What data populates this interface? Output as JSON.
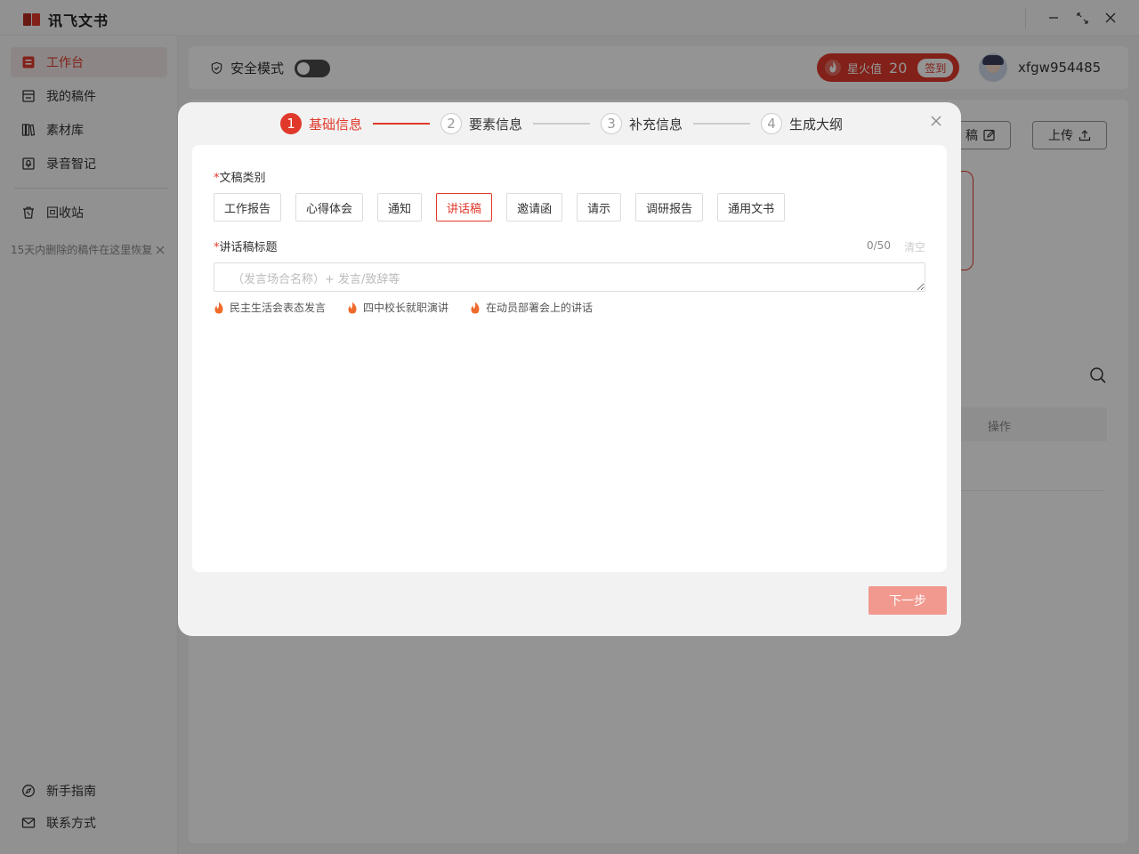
{
  "app": {
    "title": "讯飞文书"
  },
  "window": {
    "minimize_icon": "minimize-icon",
    "maximize_icon": "maximize-icon",
    "close_icon": "close-icon"
  },
  "sidebar": {
    "items": [
      {
        "label": "工作台",
        "icon": "workbench-icon",
        "active": true
      },
      {
        "label": "我的稿件",
        "icon": "drafts-icon",
        "active": false
      },
      {
        "label": "素材库",
        "icon": "library-icon",
        "active": false
      },
      {
        "label": "录音智记",
        "icon": "recording-icon",
        "active": false
      },
      {
        "label": "回收站",
        "icon": "trash-icon",
        "active": false
      }
    ],
    "recycle_tip": "15天内删除的稿件在这里恢复",
    "bottom_items": [
      {
        "label": "新手指南",
        "icon": "compass-icon"
      },
      {
        "label": "联系方式",
        "icon": "mail-icon"
      }
    ]
  },
  "topbar": {
    "safe_mode_label": "安全模式",
    "safe_mode_on": false,
    "spark_label": "星火值",
    "spark_value": "20",
    "checkin_label": "签到",
    "username": "xfgw954485"
  },
  "workspace": {
    "draft_button_label": "稿",
    "upload_button_label": "上传",
    "table_header_action": "操作"
  },
  "modal": {
    "steps": [
      {
        "num": "1",
        "label": "基础信息",
        "active": true
      },
      {
        "num": "2",
        "label": "要素信息",
        "active": false
      },
      {
        "num": "3",
        "label": "补充信息",
        "active": false
      },
      {
        "num": "4",
        "label": "生成大纲",
        "active": false
      }
    ],
    "doc_type": {
      "required_mark": "*",
      "label": "文稿类别",
      "options": [
        "工作报告",
        "心得体会",
        "通知",
        "讲话稿",
        "邀请函",
        "请示",
        "调研报告",
        "通用文书"
      ],
      "selected": "讲话稿"
    },
    "title_field": {
      "required_mark": "*",
      "label": "讲话稿标题",
      "counter": "0/50",
      "clear_label": "清空",
      "value": "",
      "placeholder": "（发言场合名称）+ 发言/致辞等"
    },
    "suggestions": [
      "民主生活会表态发言",
      "四中校长就职演讲",
      "在动员部署会上的讲话"
    ],
    "next_button_label": "下一步"
  },
  "colors": {
    "accent": "#e0392b",
    "accent_disabled": "#f2998f"
  }
}
